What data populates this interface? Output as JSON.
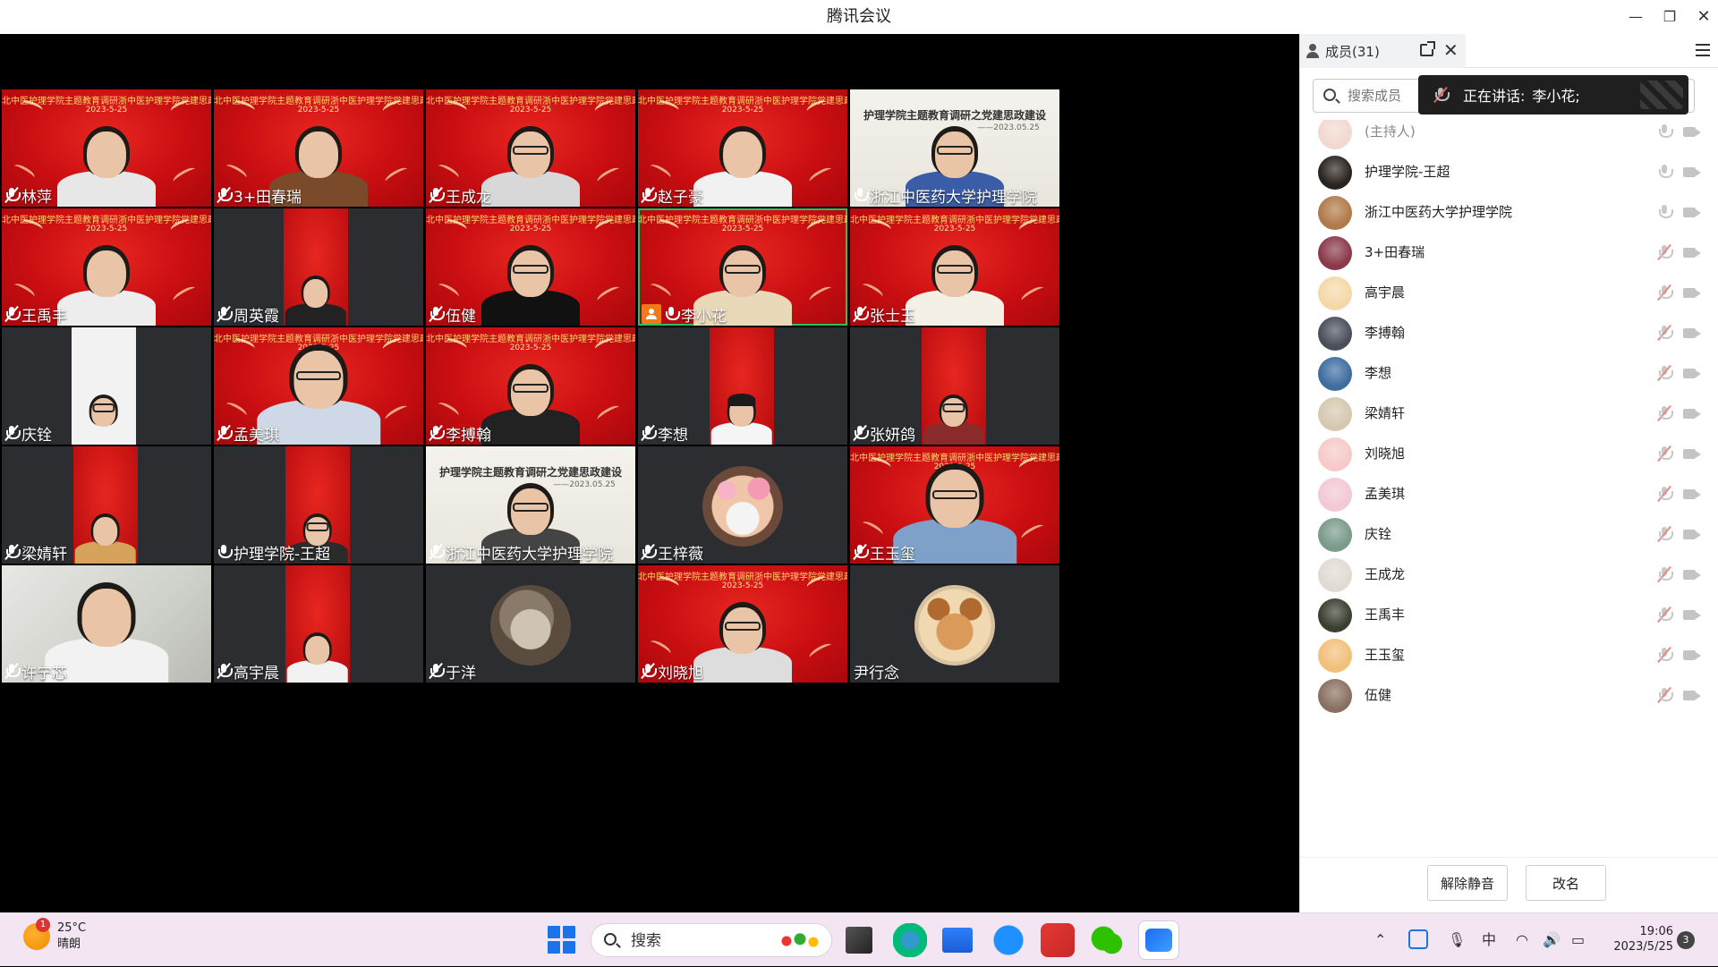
{
  "window": {
    "title": "腾讯会议",
    "minimize": "—",
    "maximize": "❐",
    "close": "✕"
  },
  "banner": {
    "text": "北中医护理学院主题教育调研浙中医护理学院党建思政建设",
    "date": "2023-5-25",
    "white_text": "护理学院主题教育调研之党建思政建设",
    "white_date": "——2023.05.25"
  },
  "tiles": [
    {
      "name": "林萍",
      "muted": true
    },
    {
      "name": "3+田春瑞",
      "muted": true
    },
    {
      "name": "王成龙",
      "muted": true
    },
    {
      "name": "赵子豪",
      "muted": true
    },
    {
      "name": "浙江中医药大学护理学院",
      "muted": false
    },
    {
      "name": "王禹丰",
      "muted": true
    },
    {
      "name": "周英霞",
      "muted": true
    },
    {
      "name": "伍健",
      "muted": true
    },
    {
      "name": "李小花",
      "muted": false,
      "host": true
    },
    {
      "name": "张士玉",
      "muted": true
    },
    {
      "name": "庆铨",
      "muted": true
    },
    {
      "name": "孟美琪",
      "muted": true
    },
    {
      "name": "李搏翰",
      "muted": true
    },
    {
      "name": "李想",
      "muted": true
    },
    {
      "name": "张妍鸽",
      "muted": true
    },
    {
      "name": "梁婧轩",
      "muted": true
    },
    {
      "name": "护理学院-王超",
      "muted": false
    },
    {
      "name": "浙江中医药大学护理学院",
      "muted": true
    },
    {
      "name": "王梓薇",
      "muted": true
    },
    {
      "name": "王玉玺",
      "muted": true
    },
    {
      "name": "许宁芯",
      "muted": true
    },
    {
      "name": "高宇晨",
      "muted": true
    },
    {
      "name": "于洋",
      "muted": true
    },
    {
      "name": "刘晓旭",
      "muted": true
    },
    {
      "name": "尹行念",
      "muted": false,
      "nomic": true
    }
  ],
  "panel": {
    "tab_label": "成员(31)",
    "search_placeholder": "搜索成员",
    "speaking_label": "正在讲话:",
    "speaking_name": "李小花;",
    "members": [
      {
        "name": "(主持人)",
        "muted": false
      },
      {
        "name": "护理学院-王超",
        "muted": false
      },
      {
        "name": "浙江中医药大学护理学院",
        "muted": false
      },
      {
        "name": "3+田春瑞",
        "muted": true
      },
      {
        "name": "高宇晨",
        "muted": true
      },
      {
        "name": "李搏翰",
        "muted": true
      },
      {
        "name": "李想",
        "muted": true
      },
      {
        "name": "梁婧轩",
        "muted": true
      },
      {
        "name": "刘晓旭",
        "muted": true
      },
      {
        "name": "孟美琪",
        "muted": true
      },
      {
        "name": "庆铨",
        "muted": true
      },
      {
        "name": "王成龙",
        "muted": true
      },
      {
        "name": "王禹丰",
        "muted": true
      },
      {
        "name": "王玉玺",
        "muted": true
      },
      {
        "name": "伍健",
        "muted": true
      }
    ],
    "unmute_label": "解除静音",
    "rename_label": "改名"
  },
  "taskbar": {
    "temperature": "25°C",
    "weather": "晴朗",
    "weather_badge": "1",
    "search_placeholder": "搜索",
    "ime": "中",
    "time": "19:06",
    "date": "2023/5/25",
    "notifications": "3"
  },
  "colors": {
    "accent": "#2fbf5b",
    "host_badge": "#f07a1a",
    "banner_red": "#c90e12"
  }
}
